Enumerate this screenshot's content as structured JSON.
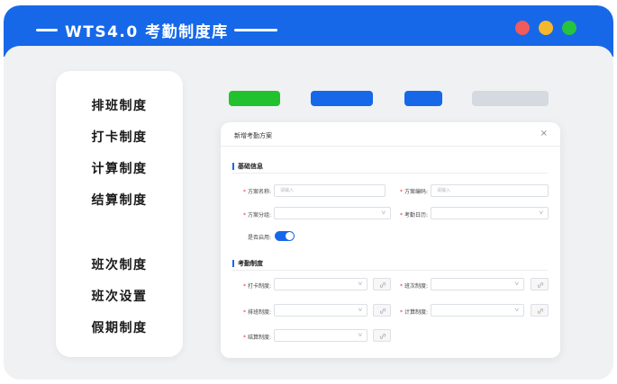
{
  "window": {
    "title": "WTS4.0 考勤制度库",
    "controls": {
      "close_color": "#f05b5b",
      "minimize_color": "#f5b72c",
      "maximize_color": "#26c33f"
    },
    "accent_color": "#1768e8"
  },
  "sidebar": {
    "items": [
      {
        "label": "排班制度"
      },
      {
        "label": "打卡制度"
      },
      {
        "label": "计算制度"
      },
      {
        "label": "结算制度"
      },
      {
        "label": "班次制度"
      },
      {
        "label": "班次设置"
      },
      {
        "label": "假期制度"
      }
    ]
  },
  "toolbar": {
    "buttons": [
      {
        "color": "#22c12e"
      },
      {
        "color": "#1768e8"
      },
      {
        "color": "#1768e8"
      },
      {
        "color": "#d5d9e0"
      }
    ]
  },
  "dialog": {
    "title": "新增考勤方案",
    "close_icon": "×",
    "basic_section": "基础信息",
    "fields": {
      "plan_name_label": "方案名称:",
      "plan_name_placeholder": "请输入",
      "plan_code_label": "方案编码:",
      "plan_code_placeholder": "请输入",
      "plan_group_label": "方案分组:",
      "calendar_label": "考勤日历:",
      "enabled_label": "是否启用:",
      "enabled": true
    },
    "rules_section": "考勤制度",
    "rules": {
      "punch_label": "打卡制度:",
      "shift_label": "班次制度:",
      "schedule_label": "排班制度:",
      "calc_label": "计算制度:",
      "settle_label": "结算制度:"
    }
  }
}
